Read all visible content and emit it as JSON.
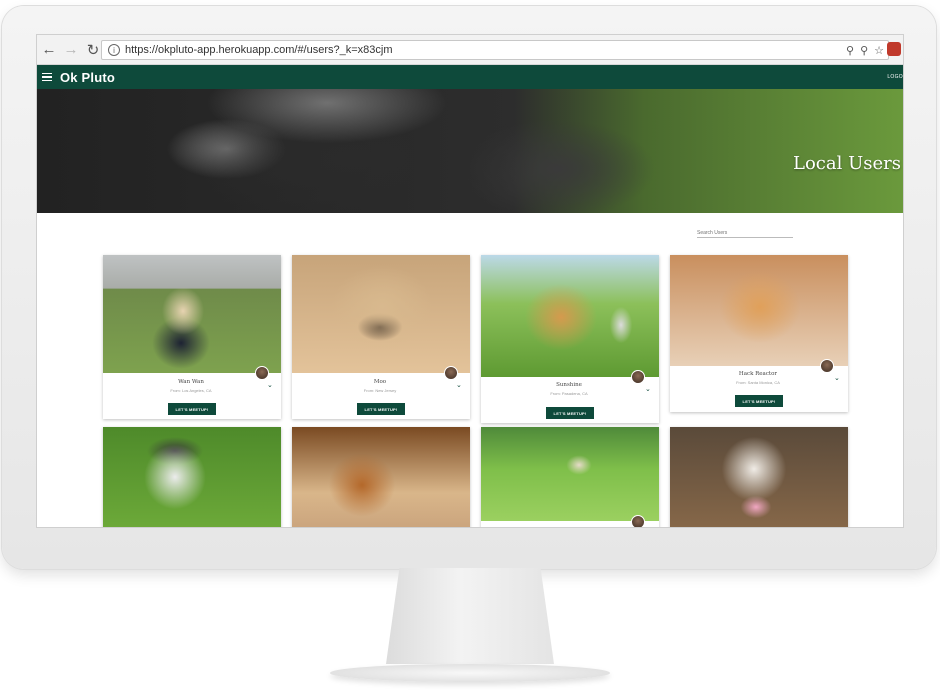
{
  "browser": {
    "url": "https://okpluto-app.herokuapp.com/#/users?_k=x83cjm",
    "back_icon": "arrow-left-icon",
    "forward_icon": "arrow-right-icon",
    "reload_icon": "reload-icon"
  },
  "app": {
    "brand": "Ok Pluto",
    "logout": "LOGO",
    "accent": "#0e4a3b"
  },
  "hero": {
    "title": "Local Users"
  },
  "search": {
    "placeholder": "Search Users"
  },
  "cards": [
    {
      "name": "Wan Wan",
      "location": "From: Los Angeles, CA",
      "button": "LET'S MEETUP!"
    },
    {
      "name": "Moo",
      "location": "From: New Jersey",
      "button": "LET'S MEETUP!"
    },
    {
      "name": "Sunshine",
      "location": "From: Pasadena, CA",
      "button": "LET'S MEETUP!"
    },
    {
      "name": "Hack Reactor",
      "location": "From: Santa Monica, CA",
      "button": "LET'S MEETUP!"
    }
  ]
}
